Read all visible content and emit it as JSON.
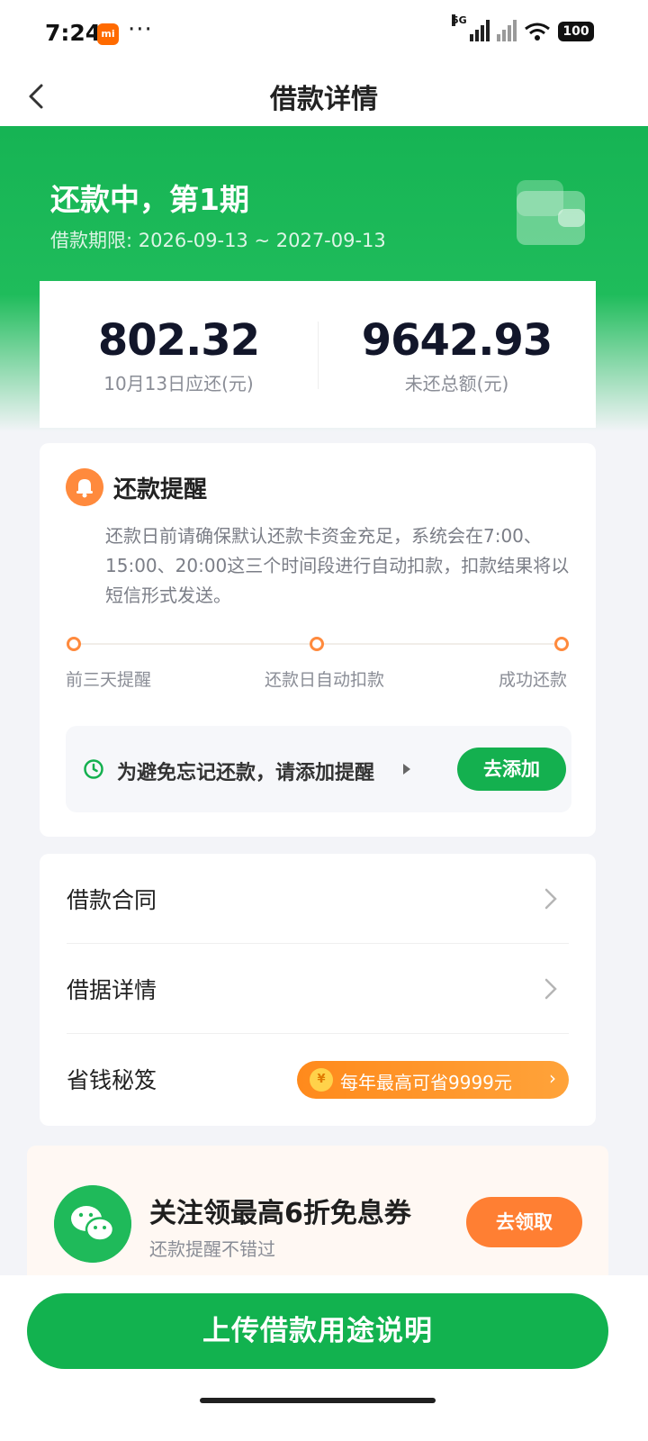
{
  "status_bar": {
    "time": "7:24",
    "mi_badge": "mi",
    "dots": "···",
    "network_label": "5G",
    "battery": "100"
  },
  "header": {
    "title": "借款详情"
  },
  "loan": {
    "status": "还款中，第1期",
    "period": "借款期限: 2026-09-13 ~ 2027-09-13"
  },
  "amounts": {
    "due": {
      "value": "802.32",
      "label": "10月13日应还(元)"
    },
    "outstanding": {
      "value": "9642.93",
      "label": "未还总额(元)"
    }
  },
  "reminder": {
    "title": "还款提醒",
    "text": "还款日前请确保默认还款卡资金充足，系统会在7:00、15:00、20:00这三个时间段进行自动扣款，扣款结果将以短信形式发送。",
    "steps": [
      "前三天提醒",
      "还款日自动扣款",
      "成功还款"
    ],
    "add_prompt": "为避免忘记还款，请添加提醒",
    "add_button": "去添加"
  },
  "menu": {
    "contract": "借款合同",
    "iou_details": "借据详情",
    "saving_tips": "省钱秘笈",
    "promo_coin": "¥",
    "promo_text": "每年最高可省9999元",
    "promo_chevron": "›"
  },
  "wechat": {
    "title": "关注领最高6折免息券",
    "subtitle": "还款提醒不错过",
    "button": "去领取"
  },
  "footer": {
    "upload_button": "上传借款用途说明"
  },
  "colors": {
    "brand_green": "#14b04f",
    "accent_orange": "#ff8a3d"
  }
}
